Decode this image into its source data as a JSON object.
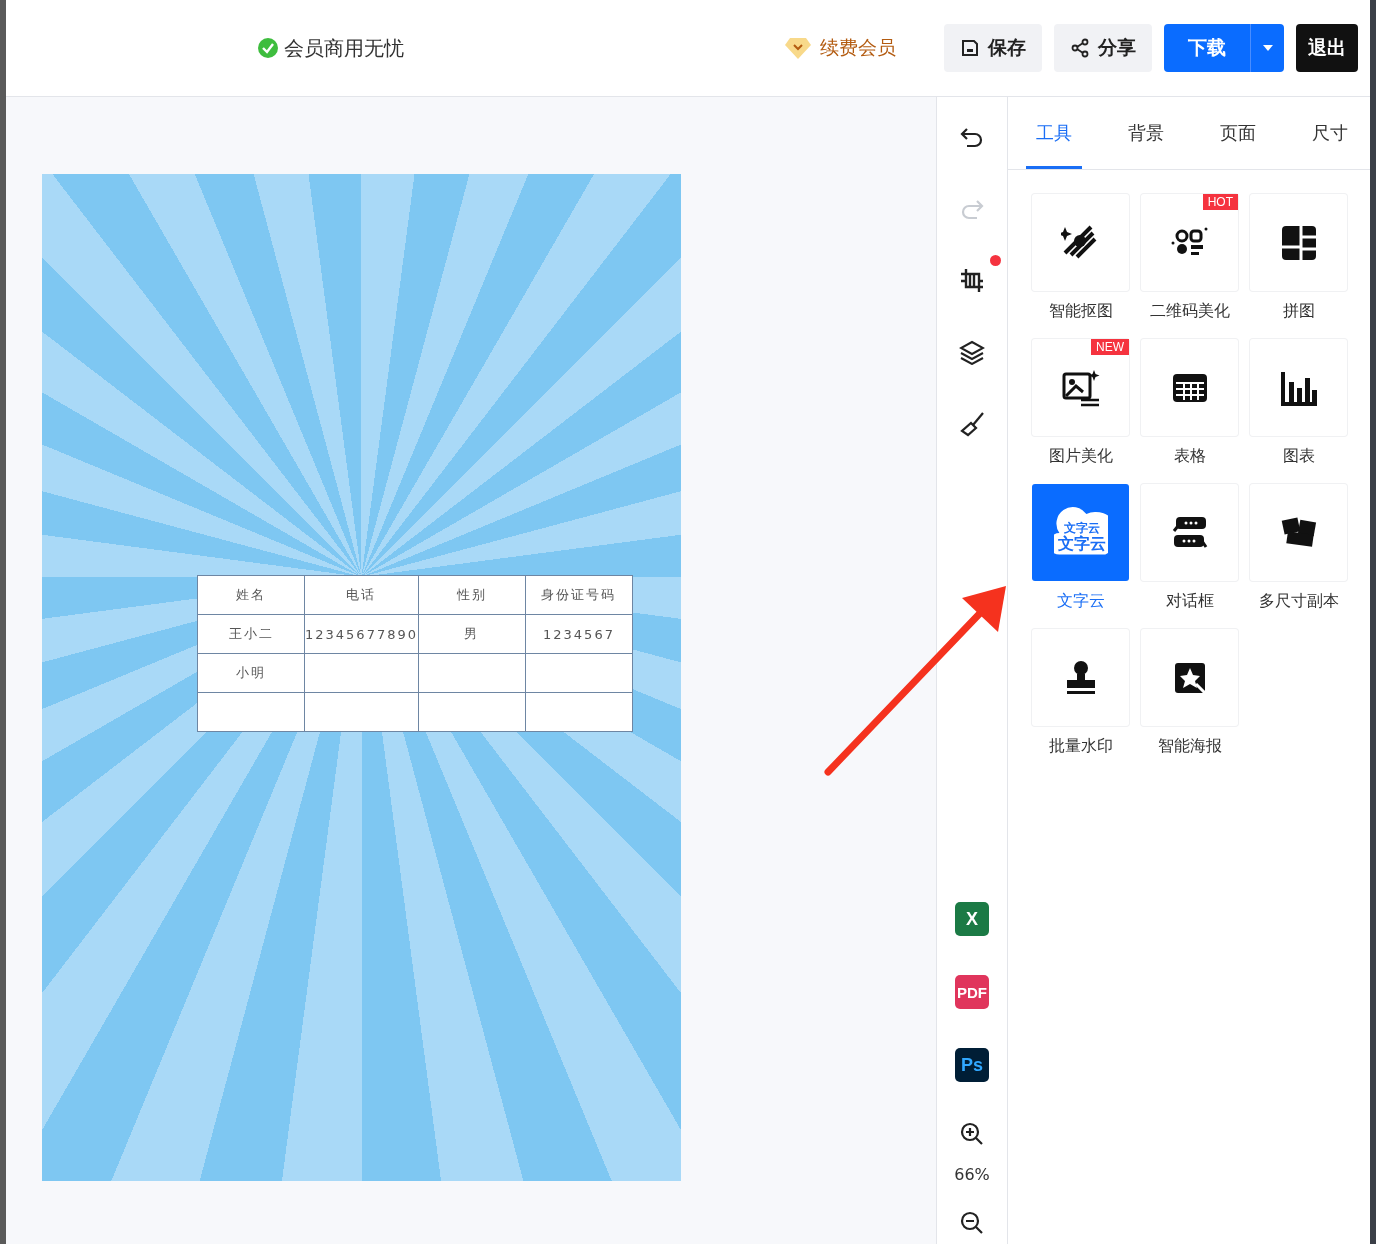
{
  "header": {
    "notice": "会员商用无忧",
    "renew": "续费会员",
    "buttons": [
      {
        "kind": "save",
        "label": "保存"
      },
      {
        "kind": "share",
        "label": "分享"
      },
      {
        "kind": "download",
        "label": "下载"
      },
      {
        "kind": "exit",
        "label": "退出"
      }
    ]
  },
  "side_toolbar": {
    "tools": [
      {
        "kind": "undo",
        "disabled": false,
        "notification": false
      },
      {
        "kind": "redo",
        "disabled": true,
        "notification": false
      },
      {
        "kind": "crop",
        "disabled": false,
        "notification": true
      },
      {
        "kind": "layers",
        "disabled": false,
        "notification": false
      },
      {
        "kind": "brush",
        "disabled": false,
        "notification": false
      }
    ],
    "exports": [
      {
        "kind": "excel",
        "text": "X"
      },
      {
        "kind": "pdf",
        "text": "PDF"
      },
      {
        "kind": "ps",
        "text": "Ps"
      }
    ],
    "zoom": "66%"
  },
  "tabs": [
    {
      "label": "工具",
      "selected": true
    },
    {
      "label": "背景",
      "selected": false
    },
    {
      "label": "页面",
      "selected": false
    },
    {
      "label": "尺寸",
      "selected": false
    }
  ],
  "tools": [
    {
      "kind": "cutout",
      "label": "智能抠图",
      "selected": false
    },
    {
      "kind": "qrcode",
      "label": "二维码美化",
      "selected": false,
      "badge": "HOT"
    },
    {
      "kind": "collage",
      "label": "拼图",
      "selected": false
    },
    {
      "kind": "beautify",
      "label": "图片美化",
      "selected": false,
      "badge": "NEW"
    },
    {
      "kind": "table",
      "label": "表格",
      "selected": false
    },
    {
      "kind": "chart",
      "label": "图表",
      "selected": false
    },
    {
      "kind": "wordcloud",
      "label": "文字云",
      "selected": true,
      "icon_text": [
        "文字云",
        "文字云"
      ]
    },
    {
      "kind": "dialog",
      "label": "对话框",
      "selected": false
    },
    {
      "kind": "copies",
      "label": "多尺寸副本",
      "selected": false
    },
    {
      "kind": "stamp",
      "label": "批量水印",
      "selected": false
    },
    {
      "kind": "poster",
      "label": "智能海报",
      "selected": false
    }
  ],
  "canvas": {
    "table": {
      "columns": [
        "姓名",
        "电话",
        "性别",
        "身份证号码"
      ],
      "rows": [
        [
          "王小二",
          "12345677890",
          "男",
          "1234567"
        ],
        [
          "小明",
          "",
          "",
          ""
        ],
        [
          "",
          "",
          "",
          ""
        ]
      ]
    }
  }
}
